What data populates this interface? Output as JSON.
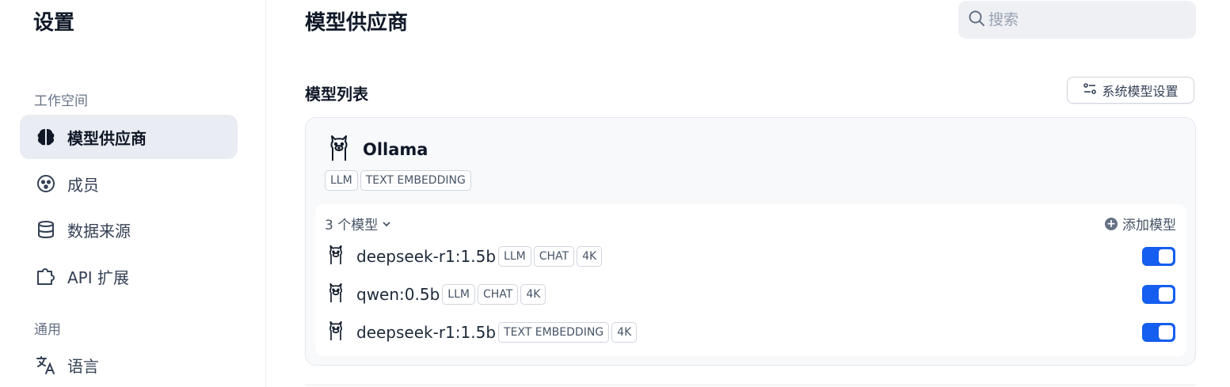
{
  "sidebar": {
    "title": "设置",
    "groups": {
      "workspace": "工作空间",
      "general": "通用"
    },
    "items": [
      {
        "label": "模型供应商",
        "icon": "brain-icon",
        "active": true
      },
      {
        "label": "成员",
        "icon": "members-icon"
      },
      {
        "label": "数据来源",
        "icon": "database-icon"
      },
      {
        "label": "API 扩展",
        "icon": "puzzle-icon"
      },
      {
        "label": "语言",
        "icon": "translate-icon"
      }
    ]
  },
  "header": {
    "title": "模型供应商",
    "search_placeholder": "搜索"
  },
  "model_list": {
    "title": "模型列表",
    "system_settings_label": "系统模型设置"
  },
  "provider": {
    "name": "Ollama",
    "icon": "llama-icon",
    "tags": [
      "LLM",
      "TEXT EMBEDDING"
    ],
    "count_label": "3 个模型",
    "add_model_label": "添加模型",
    "models": [
      {
        "name": "deepseek-r1:1.5b",
        "tags": [
          "LLM",
          "CHAT",
          "4K"
        ],
        "enabled": true
      },
      {
        "name": "qwen:0.5b",
        "tags": [
          "LLM",
          "CHAT",
          "4K"
        ],
        "enabled": true
      },
      {
        "name": "deepseek-r1:1.5b",
        "tags": [
          "TEXT EMBEDDING",
          "4K"
        ],
        "enabled": true
      }
    ]
  },
  "colors": {
    "accent": "#155eef",
    "active_bg": "#e9ecf2"
  }
}
